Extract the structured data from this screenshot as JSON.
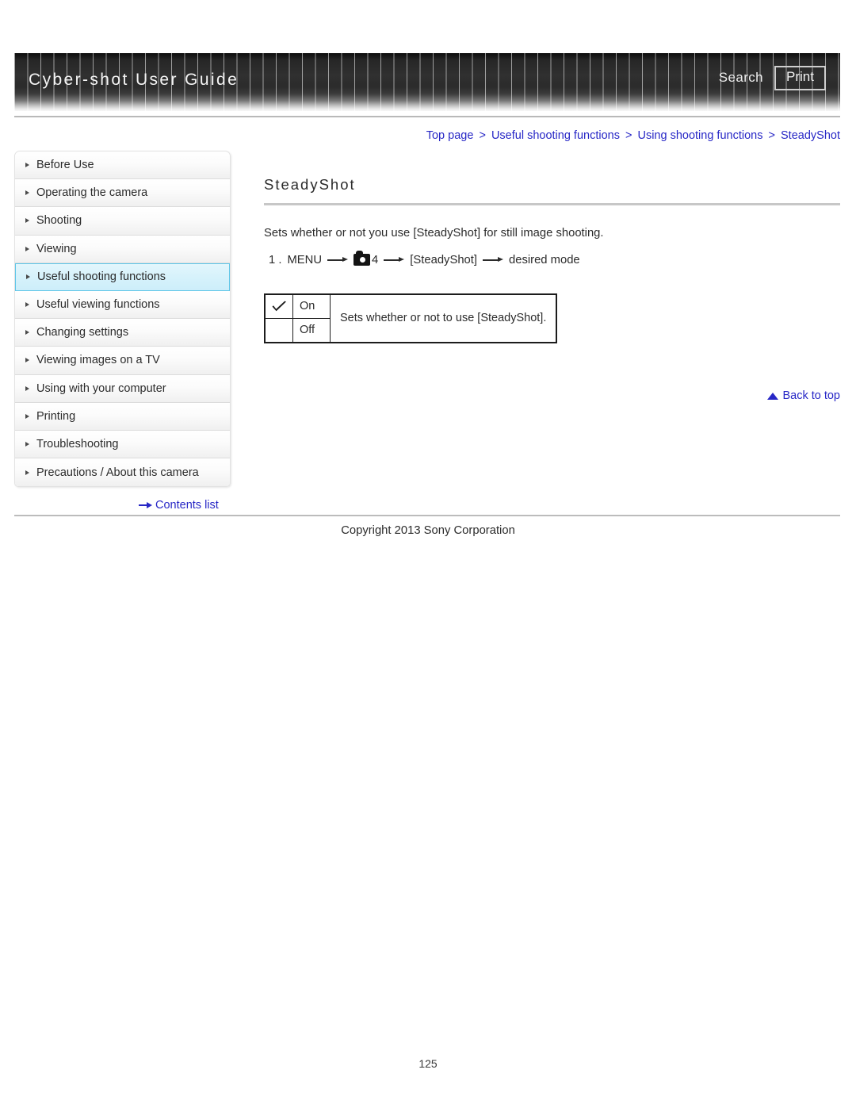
{
  "header": {
    "title": "Cyber-shot User Guide",
    "search_label": "Search",
    "print_label": "Print"
  },
  "breadcrumb": {
    "separator": ">",
    "items": [
      {
        "label": "Top page"
      },
      {
        "label": "Useful shooting functions"
      },
      {
        "label": "Using shooting functions"
      },
      {
        "label": "SteadyShot"
      }
    ]
  },
  "sidebar": {
    "items": [
      {
        "label": "Before Use",
        "active": false
      },
      {
        "label": "Operating the camera",
        "active": false
      },
      {
        "label": "Shooting",
        "active": false
      },
      {
        "label": "Viewing",
        "active": false
      },
      {
        "label": "Useful shooting functions",
        "active": true
      },
      {
        "label": "Useful viewing functions",
        "active": false
      },
      {
        "label": "Changing settings",
        "active": false
      },
      {
        "label": "Viewing images on a TV",
        "active": false
      },
      {
        "label": "Using with your computer",
        "active": false
      },
      {
        "label": "Printing",
        "active": false
      },
      {
        "label": "Troubleshooting",
        "active": false
      },
      {
        "label": "Precautions / About this camera",
        "active": false
      }
    ],
    "contents_list_label": "Contents list",
    "contents_list_icon": "arrow-right-icon",
    "active_color": "#cdeefa",
    "active_border_color": "#5fc6e8"
  },
  "main": {
    "title": "SteadyShot",
    "intro": "Sets whether or not you use [SteadyShot] for still image shooting.",
    "step": {
      "number": "1 .",
      "menu_label": "MENU",
      "camera_icon": "camera-icon",
      "tab_number": "4",
      "setting_label": "[SteadyShot]",
      "result_label": "desired mode"
    },
    "option_table": {
      "rows": [
        {
          "checked": true,
          "option": "On"
        },
        {
          "checked": false,
          "option": "Off"
        }
      ],
      "description": "Sets whether or not to use [SteadyShot]."
    },
    "back_to_top_label": "Back to top",
    "back_to_top_icon": "triangle-up-icon"
  },
  "footer": {
    "copyright": "Copyright 2013 Sony Corporation",
    "page_number": "125"
  },
  "colors": {
    "link": "#2727c6",
    "text": "#2b2b2b",
    "header_dark": "#262626"
  }
}
